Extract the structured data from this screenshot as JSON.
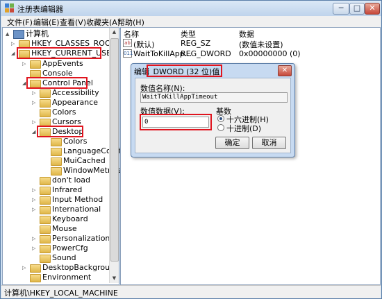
{
  "window": {
    "title": "注册表编辑器",
    "controls": {
      "minimize": "─",
      "maximize": "□",
      "close": "✕"
    }
  },
  "menu": [
    "文件(F)",
    "编辑(E)",
    "查看(V)",
    "收藏夹(A)",
    "帮助(H)"
  ],
  "tree": [
    {
      "label": "计算机",
      "expander": "▲"
    },
    {
      "label": "HKEY_CLASSES_ROOT",
      "expander": "▷"
    },
    {
      "label": "HKEY_CURRENT_USER",
      "expander": "◢"
    },
    {
      "label": "AppEvents",
      "expander": "▷"
    },
    {
      "label": "Console",
      "expander": ""
    },
    {
      "label": "Control Panel",
      "expander": "◢"
    },
    {
      "label": "Accessibility",
      "expander": "▷"
    },
    {
      "label": "Appearance",
      "expander": "▷"
    },
    {
      "label": "Colors",
      "expander": ""
    },
    {
      "label": "Cursors",
      "expander": "▷"
    },
    {
      "label": "Desktop",
      "expander": "◢"
    },
    {
      "label": "Colors",
      "expander": ""
    },
    {
      "label": "LanguageConfig",
      "expander": ""
    },
    {
      "label": "MuiCached",
      "expander": ""
    },
    {
      "label": "WindowMetrics",
      "expander": ""
    },
    {
      "label": "don't load",
      "expander": ""
    },
    {
      "label": "Infrared",
      "expander": "▷"
    },
    {
      "label": "Input Method",
      "expander": "▷"
    },
    {
      "label": "International",
      "expander": "▷"
    },
    {
      "label": "Keyboard",
      "expander": ""
    },
    {
      "label": "Mouse",
      "expander": ""
    },
    {
      "label": "Personalization",
      "expander": "▷"
    },
    {
      "label": "PowerCfg",
      "expander": "▷"
    },
    {
      "label": "Sound",
      "expander": ""
    },
    {
      "label": "DesktopBackground",
      "expander": "▷"
    },
    {
      "label": "Environment",
      "expander": ""
    }
  ],
  "columns": {
    "name": "名称",
    "type": "类型",
    "data": "数据"
  },
  "values": [
    {
      "name": "(默认)",
      "type": "REG_SZ",
      "data": "(数值未设置)",
      "icon": "ab"
    },
    {
      "name": "WaitToKillApp...",
      "type": "REG_DWORD",
      "data": "0x00000000 (0)",
      "icon": "011"
    }
  ],
  "status": "计算机\\HKEY_LOCAL_MACHINE",
  "dialog": {
    "title_prefix": "编辑",
    "title_highlight": "DWORD (32 位)值",
    "close": "✕",
    "name_label": "数值名称(N):",
    "name_value": "WaitToKillAppTimeout",
    "data_label": "数值数据(V):",
    "data_value": "0",
    "base_label": "基数",
    "hex_label": "十六进制(H)",
    "dec_label": "十进制(D)",
    "ok": "确定",
    "cancel": "取消"
  }
}
